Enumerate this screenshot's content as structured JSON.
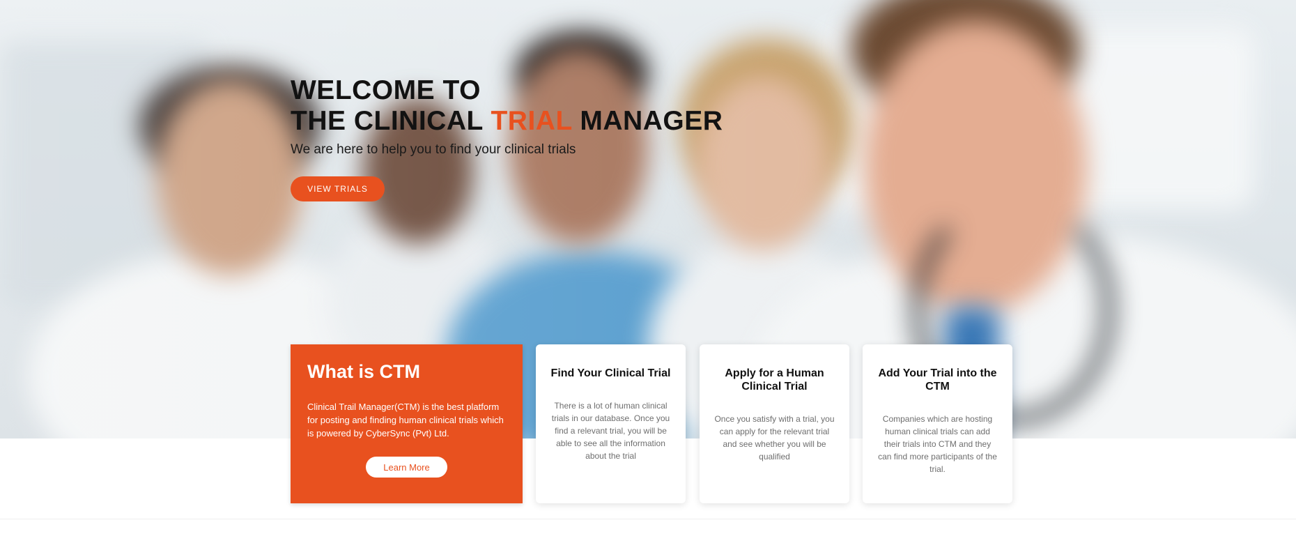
{
  "hero": {
    "title_line1": "WELCOME TO",
    "title_line2_pre": "THE CLINICAL ",
    "title_line2_accent": "TRIAL",
    "title_line2_post": " MANAGER",
    "subtitle": "We are here to help you to find your clinical trials",
    "view_button": "VIEW TRIALS"
  },
  "about": {
    "title": "What is CTM",
    "description": "Clinical Trail Manager(CTM) is the best platform for posting and finding human clinical trials which is powered by CyberSync (Pvt) Ltd.",
    "learn_more": "Learn More"
  },
  "features": [
    {
      "title": "Find Your Clinical Trial",
      "text": "There is a lot of human clinical trials in our database. Once you find a relevant trial, you will be able to see all the information about the trial"
    },
    {
      "title": "Apply for a Human Clinical Trial",
      "text": "Once you satisfy with a trial, you can apply for the relevant trial and see whether you will be qualified"
    },
    {
      "title": "Add Your Trial into the CTM",
      "text": "Companies which are hosting human clinical trials can add their trials into CTM and they can find more participants of the trial."
    }
  ],
  "colors": {
    "accent": "#e8511f",
    "text_dark": "#121212",
    "text_muted": "#6e6e6e"
  }
}
